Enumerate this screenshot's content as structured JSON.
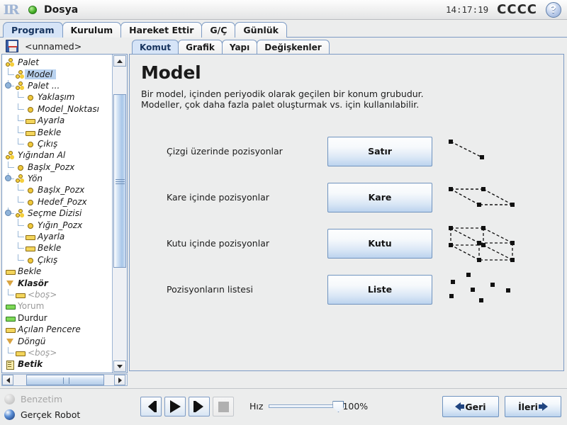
{
  "titlebar": {
    "logo": "ur-logo",
    "status_icon": "green-ball-icon",
    "file_menu_label": "Dosya",
    "clock": "14:17:19",
    "robot_name": "CCCC",
    "help_label": "?"
  },
  "main_tabs": [
    {
      "label": "Program",
      "active": true
    },
    {
      "label": "Kurulum",
      "active": false
    },
    {
      "label": "Hareket Ettir",
      "active": false
    },
    {
      "label": "G/Ç",
      "active": false
    },
    {
      "label": "Günlük",
      "active": false
    }
  ],
  "program_panel": {
    "file_icon": "floppy-save-icon",
    "file_name": "<unnamed>",
    "tree": [
      {
        "label": "Palet",
        "depth": 0,
        "icon": "palette-icon",
        "style": "italic"
      },
      {
        "label": "Model",
        "depth": 1,
        "icon": "palette-icon",
        "style": "italic",
        "selected": true
      },
      {
        "label": "Palet ...",
        "depth": 1,
        "icon": "palette-icon",
        "style": "italic",
        "expander": true
      },
      {
        "label": "Yaklaşım",
        "depth": 2,
        "icon": "dot-icon",
        "style": "italic"
      },
      {
        "label": "Model_Noktası",
        "depth": 2,
        "icon": "dot-icon",
        "style": "italic"
      },
      {
        "label": "Ayarla",
        "depth": 2,
        "icon": "bar-icon",
        "style": "italic"
      },
      {
        "label": "Bekle",
        "depth": 2,
        "icon": "bar-icon",
        "style": "italic"
      },
      {
        "label": "Çıkış",
        "depth": 2,
        "icon": "dot-icon",
        "style": "italic"
      },
      {
        "label": "Yığından Al",
        "depth": 0,
        "icon": "palette-icon",
        "style": "italic"
      },
      {
        "label": "Başlx_Pozx",
        "depth": 1,
        "icon": "dot-icon",
        "style": "italic"
      },
      {
        "label": "Yön",
        "depth": 1,
        "icon": "palette-icon",
        "style": "italic",
        "expander": true
      },
      {
        "label": "Başlx_Pozx",
        "depth": 2,
        "icon": "dot-icon",
        "style": "italic"
      },
      {
        "label": "Hedef_Pozx",
        "depth": 2,
        "icon": "dot-icon",
        "style": "italic"
      },
      {
        "label": "Seçme Dizisi",
        "depth": 1,
        "icon": "palette-icon",
        "style": "italic",
        "expander": true
      },
      {
        "label": "Yığın_Pozx",
        "depth": 2,
        "icon": "dot-icon",
        "style": "italic"
      },
      {
        "label": "Ayarla",
        "depth": 2,
        "icon": "bar-icon",
        "style": "italic"
      },
      {
        "label": "Bekle",
        "depth": 2,
        "icon": "bar-icon",
        "style": "italic"
      },
      {
        "label": "Çıkış",
        "depth": 2,
        "icon": "dot-icon",
        "style": "italic"
      },
      {
        "label": "Bekle",
        "depth": 0,
        "icon": "bar-icon",
        "style": "italic"
      },
      {
        "label": "Klasör",
        "depth": 0,
        "icon": "triangle-icon",
        "style": "bold-italic"
      },
      {
        "label": "<boş>",
        "depth": 1,
        "icon": "bar-icon",
        "style": "italic-gray"
      },
      {
        "label": "Yorum",
        "depth": 0,
        "icon": "bar-green-icon",
        "style": "plain-gray"
      },
      {
        "label": "Durdur",
        "depth": 0,
        "icon": "bar-green-icon",
        "style": "plain"
      },
      {
        "label": "Açılan Pencere",
        "depth": 0,
        "icon": "bar-icon",
        "style": "italic"
      },
      {
        "label": "Döngü",
        "depth": 0,
        "icon": "triangle-icon",
        "style": "italic"
      },
      {
        "label": "<boş>",
        "depth": 1,
        "icon": "bar-icon",
        "style": "italic-gray"
      },
      {
        "label": "Betik",
        "depth": 0,
        "icon": "script-icon",
        "style": "bold-italic"
      }
    ],
    "toolbar": {
      "undo": "undo-arrow-icon",
      "redo": "redo-arrow-icon",
      "go": "go-circle-icon",
      "move": "move-left-right-icon"
    },
    "scrollbars": {
      "v_up": "scroll-up-arrow-icon",
      "v_down": "scroll-down-arrow-icon",
      "h_left": "scroll-left-arrow-icon",
      "h_right": "scroll-right-arrow-icon"
    }
  },
  "content_tabs": [
    {
      "label": "Komut",
      "active": true
    },
    {
      "label": "Grafik",
      "active": false
    },
    {
      "label": "Yapı",
      "active": false
    },
    {
      "label": "Değişkenler",
      "active": false
    }
  ],
  "content": {
    "title": "Model",
    "description_line1": "Bir model, içinden periyodik olarak geçilen bir konum grubudur.",
    "description_line2": "Modeller, çok daha fazla palet oluşturmak vs. için kullanılabilir.",
    "rows": [
      {
        "label": "Çizgi üzerinde pozisyonlar",
        "button": "Satır",
        "diagram": "line-pattern-icon"
      },
      {
        "label": "Kare içinde pozisyonlar",
        "button": "Kare",
        "diagram": "square-pattern-icon"
      },
      {
        "label": "Kutu içinde pozisyonlar",
        "button": "Kutu",
        "diagram": "box-pattern-icon"
      },
      {
        "label": "Pozisyonların listesi",
        "button": "Liste",
        "diagram": "list-pattern-icon"
      }
    ]
  },
  "bottom": {
    "simulation_label": "Benzetim",
    "real_robot_label": "Gerçek Robot",
    "transport": {
      "prev": "skip-back-icon",
      "play": "play-icon",
      "next": "skip-forward-icon",
      "stop": "stop-icon"
    },
    "speed_label": "Hız",
    "speed_value": "100%",
    "back_label": "Geri",
    "next_label": "İleri"
  },
  "colors": {
    "accent": "#7d9bc4",
    "tab_active": "#d6e4f7",
    "selection": "#b9d2ef",
    "icon_yellow": "#f3d55c",
    "icon_green": "#7ed957"
  }
}
